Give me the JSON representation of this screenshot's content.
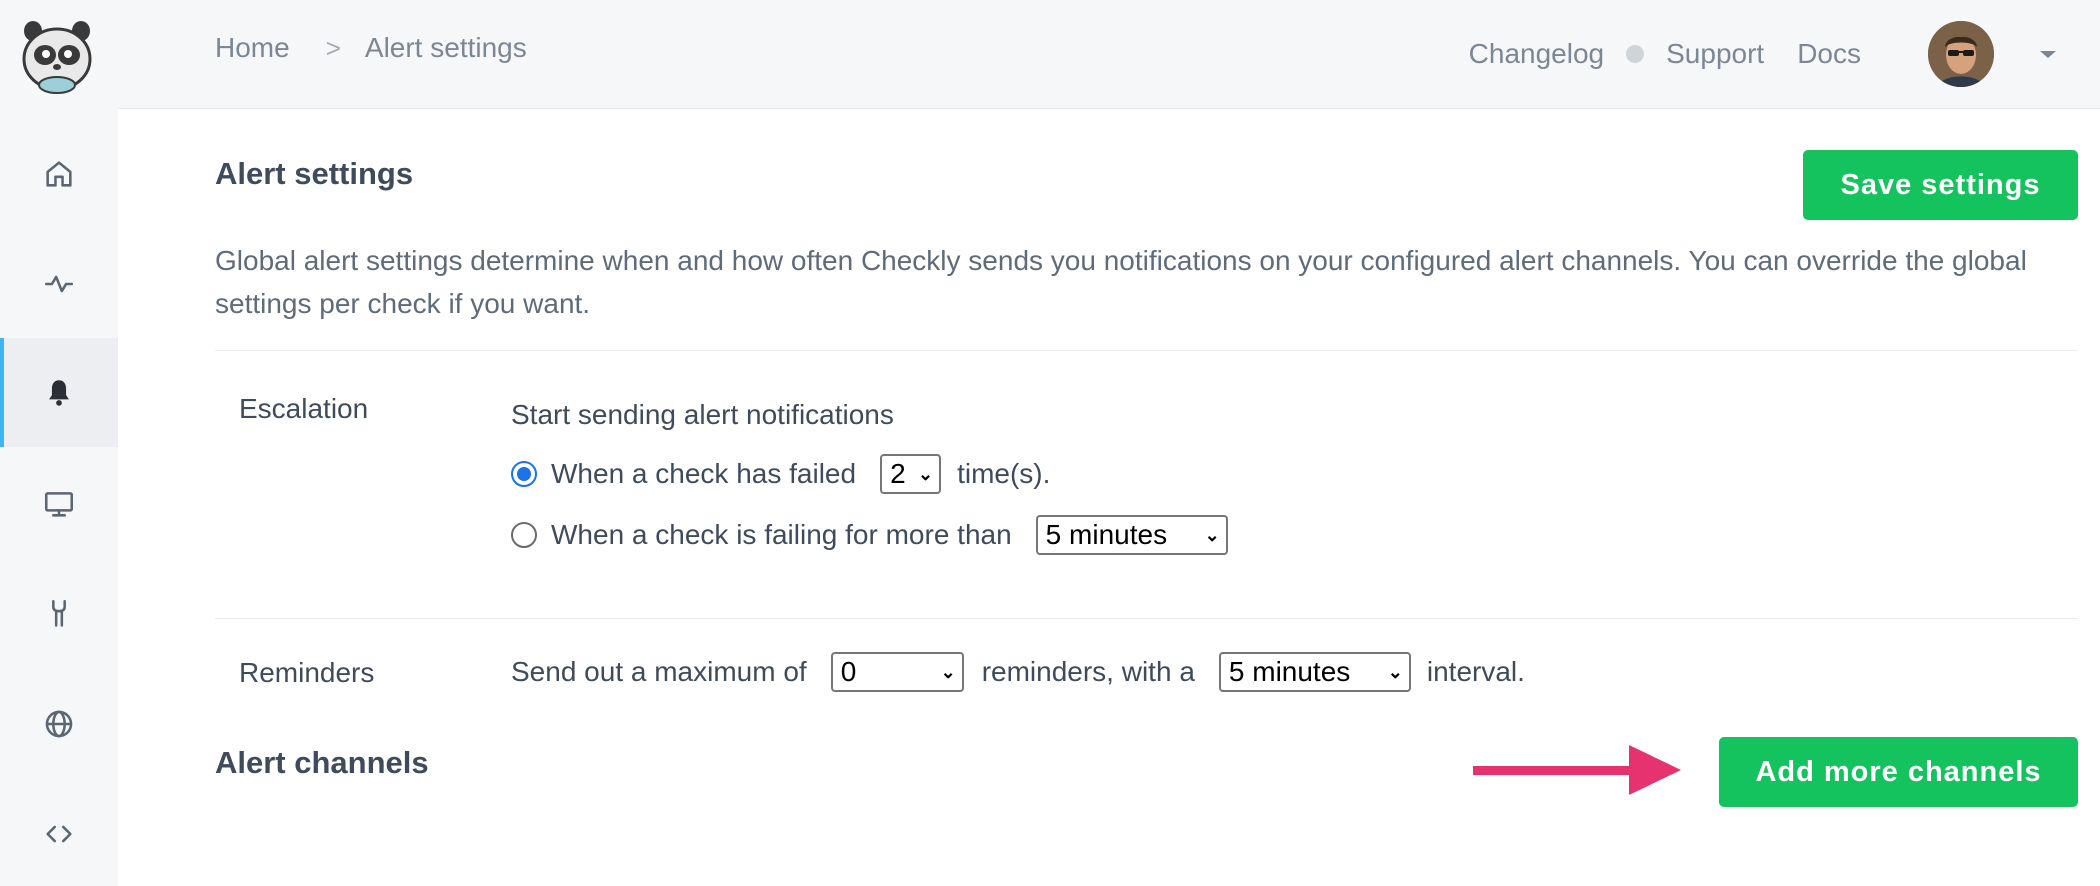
{
  "breadcrumb": {
    "home": "Home",
    "separator": ">",
    "current": "Alert settings"
  },
  "header": {
    "changelog": "Changelog",
    "support": "Support",
    "docs": "Docs"
  },
  "sidebar": {
    "items": [
      {
        "icon": "home-icon",
        "active": false
      },
      {
        "icon": "activity-icon",
        "active": false
      },
      {
        "icon": "bell-icon",
        "active": true
      },
      {
        "icon": "monitor-icon",
        "active": false
      },
      {
        "icon": "tools-icon",
        "active": false
      },
      {
        "icon": "globe-icon",
        "active": false
      },
      {
        "icon": "code-icon",
        "active": false
      }
    ]
  },
  "main": {
    "title": "Alert settings",
    "save_label": "Save settings",
    "description": "Global alert settings determine when and how often Checkly sends you notifications on your configured alert channels. You can override the global settings per check if you want."
  },
  "escalation": {
    "label": "Escalation",
    "heading": "Start sending alert notifications",
    "option1_text": "When a check has failed",
    "option1_value": "2",
    "option1_suffix": "time(s).",
    "option2_text": "When a check is failing for more than",
    "option2_value": "5 minutes",
    "selected_option": 1
  },
  "reminders": {
    "label": "Reminders",
    "prefix": "Send out a maximum of",
    "count_value": "0",
    "middle": "reminders, with a",
    "interval_value": "5 minutes",
    "suffix": "interval."
  },
  "channels": {
    "title": "Alert channels",
    "add_label": "Add more channels"
  },
  "colors": {
    "accent_green": "#14c35e",
    "active_bar": "#3fb4f2",
    "arrow": "#e6336f"
  }
}
